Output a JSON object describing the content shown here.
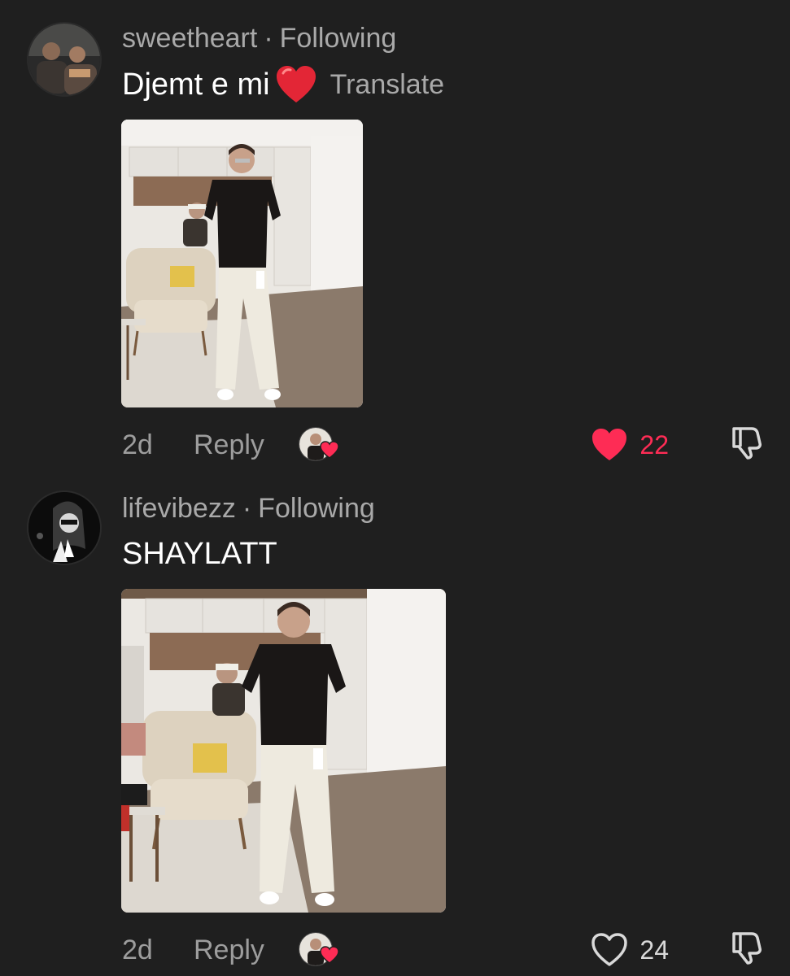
{
  "comments": [
    {
      "username": "sweetheart",
      "separator": "·",
      "follow_status": "Following",
      "text": "Djemt e mi",
      "has_heart_emoji": true,
      "translate_label": "Translate",
      "time": "2d",
      "reply_label": "Reply",
      "likes": "22",
      "liked": true
    },
    {
      "username": "lifevibezz",
      "separator": "·",
      "follow_status": "Following",
      "text": "SHAYLATT",
      "time": "2d",
      "reply_label": "Reply",
      "likes": "24",
      "liked": false
    }
  ],
  "colors": {
    "background": "#1f1f1f",
    "username": "#a9a9a9",
    "comment_text": "#ffffff",
    "meta": "#9d9d9d",
    "like_active": "#fe2c55"
  },
  "icons": {
    "like": "heart-icon",
    "dislike": "thumbs-down-icon",
    "creator_liked": "creator-liked-heart-icon"
  }
}
